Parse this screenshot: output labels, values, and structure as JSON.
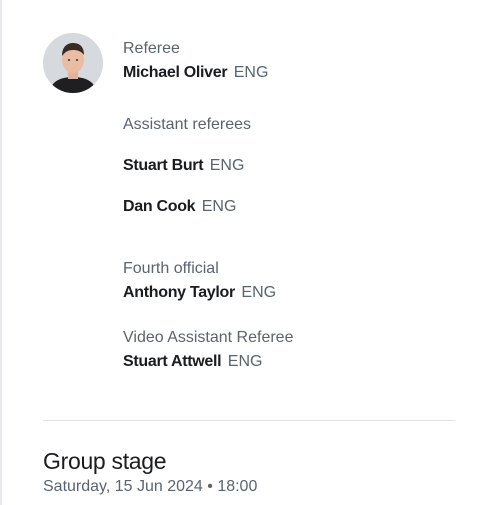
{
  "referee": {
    "role": "Referee",
    "name": "Michael Oliver",
    "country": "ENG"
  },
  "assistant_referees": {
    "role": "Assistant referees",
    "officials": [
      {
        "name": "Stuart Burt",
        "country": "ENG"
      },
      {
        "name": "Dan Cook",
        "country": "ENG"
      }
    ]
  },
  "fourth_official": {
    "role": "Fourth official",
    "name": "Anthony Taylor",
    "country": "ENG"
  },
  "var": {
    "role": "Video Assistant Referee",
    "name": "Stuart Attwell",
    "country": "ENG"
  },
  "match": {
    "stage": "Group stage",
    "datetime": "Saturday, 15 Jun 2024 • 18:00"
  },
  "colors": {
    "text_primary": "#1a1c1f",
    "text_secondary": "#5a6470",
    "divider": "#dfe2e6"
  }
}
